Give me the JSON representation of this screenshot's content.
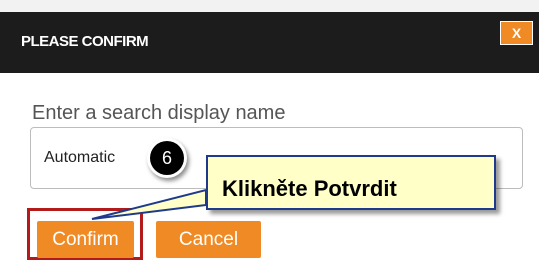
{
  "dialog": {
    "title": "PLEASE CONFIRM",
    "close_label": "X",
    "field_label": "Enter a search display name",
    "field_value": "Automatic",
    "confirm_label": "Confirm",
    "cancel_label": "Cancel"
  },
  "annotation": {
    "step_number": "6",
    "callout_text": "Klikněte Potvrdit"
  },
  "colors": {
    "titlebar": "#1c1c1c",
    "accent_orange": "#f08a24",
    "highlight_red": "#b31b1b",
    "callout_fill": "#ffffc7",
    "callout_border": "#1e3a8a"
  }
}
